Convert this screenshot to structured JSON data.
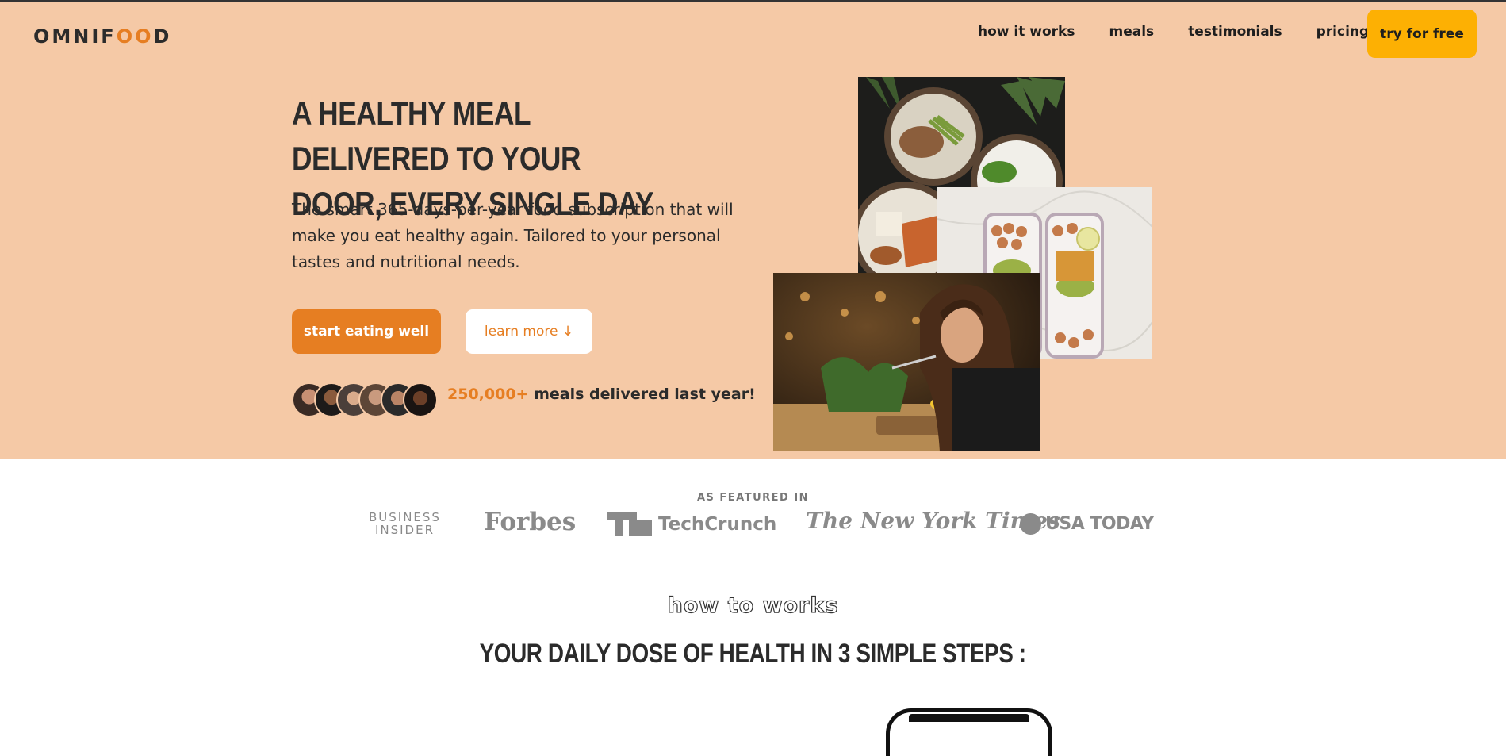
{
  "brand": {
    "logo_text_before": "OMNIF",
    "logo_text_accent": "OO",
    "logo_text_after": "D",
    "accent_color": "#e67e22",
    "hero_bg": "#f5c9a6",
    "cta_color": "#fdb003"
  },
  "nav": {
    "items": [
      {
        "label": "how it works"
      },
      {
        "label": "meals"
      },
      {
        "label": "testimonials"
      },
      {
        "label": "pricing"
      }
    ],
    "cta_label": "try for free"
  },
  "hero": {
    "title": "A HEALTHY MEAL DELIVERED TO YOUR DOOR, EVERY SINGLE DAY",
    "description": "The smart 365-days-per-year food subscription that will make you eat healthy again. Tailored to your personal tastes and nutritional needs.",
    "primary_button": "start eating well",
    "secondary_button": "learn more ↓",
    "delivered_count": "250,000+",
    "delivered_text": " meals delivered last year!",
    "avatars": [
      "customer-1",
      "customer-2",
      "customer-3",
      "customer-4",
      "customer-5",
      "customer-6"
    ]
  },
  "featured": {
    "label": "AS FEATURED IN",
    "logos": {
      "business_insider_line1": "BUSINESS",
      "business_insider_line2": "INSIDER",
      "forbes": "Forbes",
      "techcrunch": "TechCrunch",
      "nyt": "The New York Times",
      "usatoday": "USA TODAY"
    }
  },
  "how": {
    "subheading": "how to works",
    "title": "YOUR DAILY DOSE OF HEALTH IN 3 SIMPLE STEPS :"
  }
}
